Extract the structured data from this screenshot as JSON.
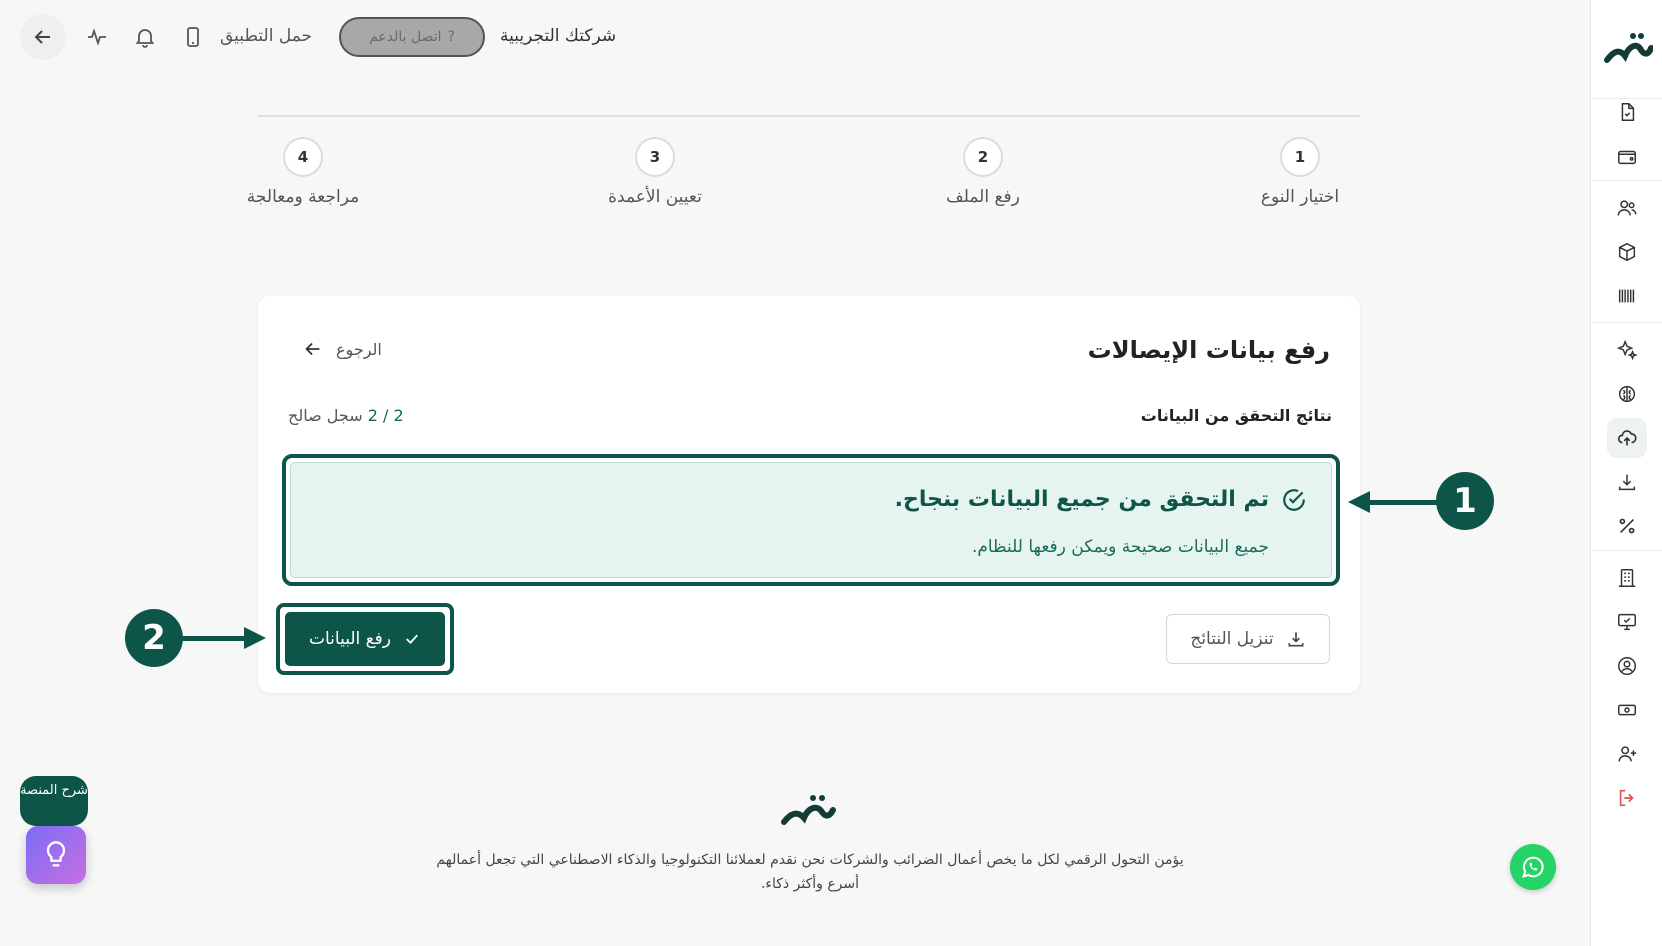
{
  "topbar": {
    "download_app_label": "حمل التطبيق",
    "support_label": "اتصل بالدعم",
    "company_name": "شركتك التجريبية"
  },
  "stepper": {
    "steps": [
      {
        "number": "1",
        "label": "اختيار النوع"
      },
      {
        "number": "2",
        "label": "رفع الملف"
      },
      {
        "number": "3",
        "label": "تعيين الأعمدة"
      },
      {
        "number": "4",
        "label": "مراجعة ومعالجة"
      }
    ]
  },
  "card": {
    "title": "رفع بيانات الإيصالات",
    "back_label": "الرجوع",
    "validation_title": "نتائج التحقق من البيانات",
    "valid_count": "2 / 2",
    "valid_label": "سجل صالح",
    "success_heading": "تم التحقق من جميع البيانات بنجاح.",
    "success_message": "جميع البيانات صحيحة ويمكن رفعها للنظام.",
    "upload_button": "رفع البيانات",
    "download_button": "تنزيل النتائج"
  },
  "annotations": {
    "badge_1": "1",
    "badge_2": "2"
  },
  "footer": {
    "text": "يؤمن التحول الرقمي لكل ما يخص أعمال الضرائب والشركات نحن نقدم لعملائنا التكنولوجيا والذكاء الاصطناعي التي تجعل أعمالهم أسرع وأكثر ذكاء."
  },
  "floating": {
    "help_label": "شرح المنصة"
  },
  "colors": {
    "primary": "#0e5549",
    "success_bg": "#e6f4f0",
    "page_bg": "#f7f7f7"
  },
  "icons": {
    "sidebar": [
      "document-check-icon",
      "wallet-icon",
      "users-icon",
      "box-icon",
      "barcode-icon",
      "sparkle-icon",
      "brain-icon",
      "cloud-upload-icon",
      "download-icon",
      "percent-icon",
      "building-icon",
      "monitor-check-icon",
      "user-circle-icon",
      "cash-icon",
      "user-plus-icon",
      "logout-icon"
    ]
  }
}
